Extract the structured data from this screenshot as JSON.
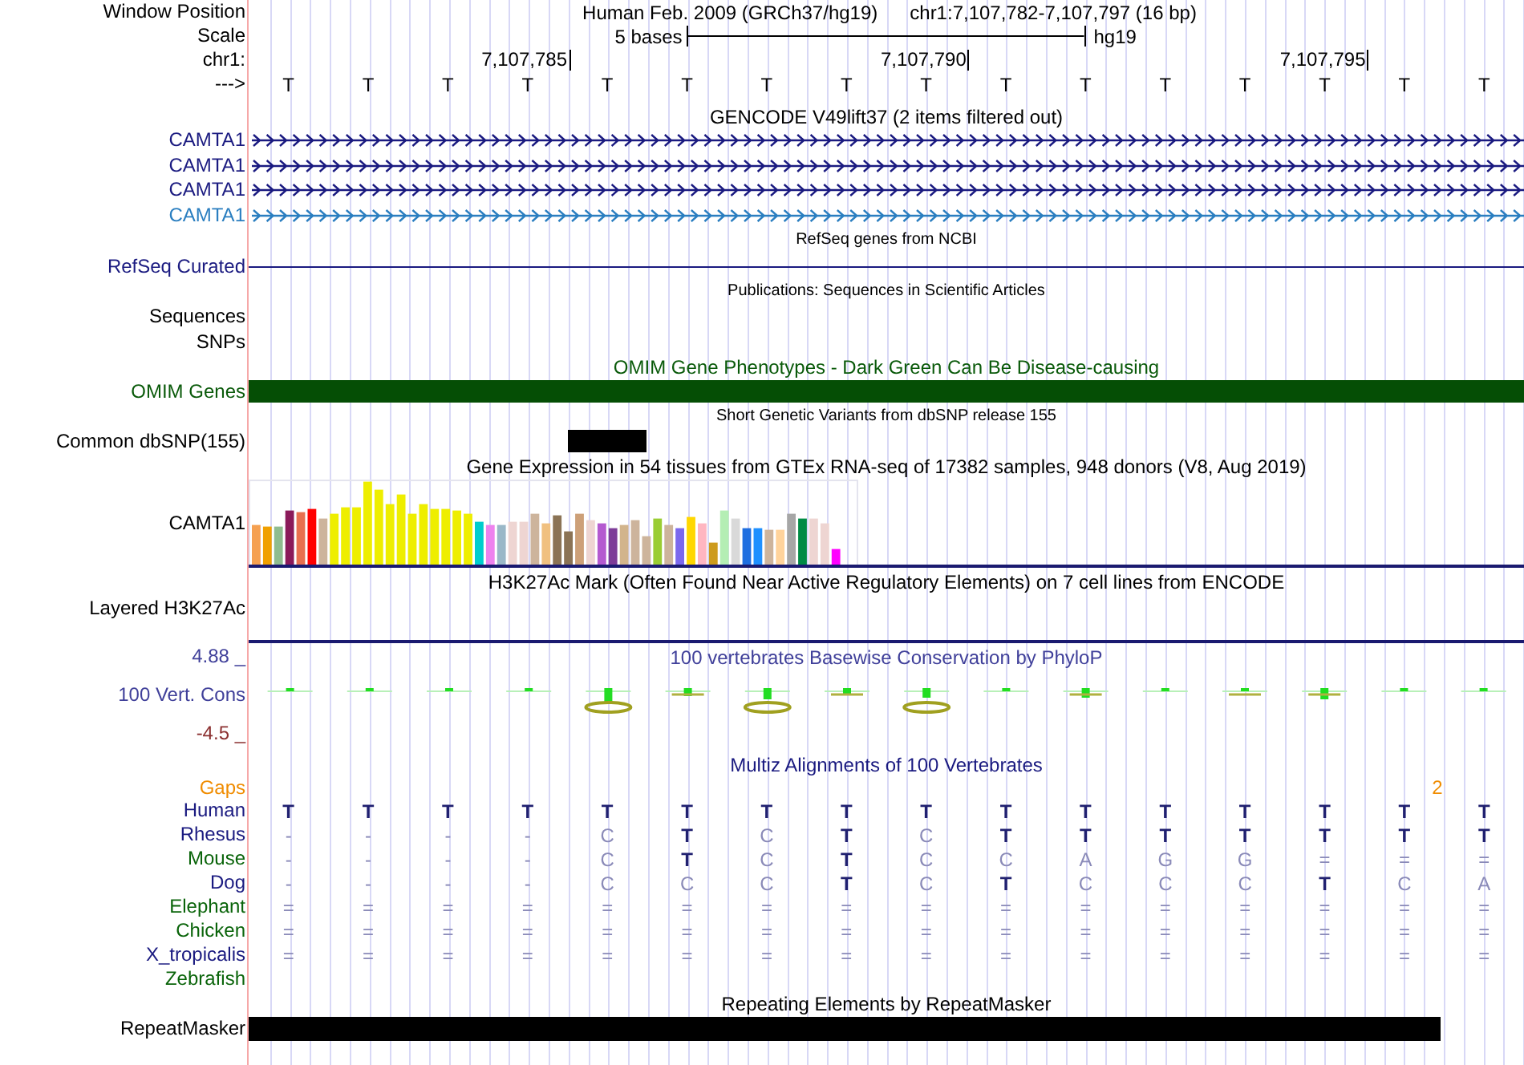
{
  "header": {
    "window_position_label": "Window Position",
    "assembly": "Human Feb. 2009 (GRCh37/hg19)",
    "position": "chr1:7,107,782-7,107,797 (16 bp)",
    "scale_label": "Scale",
    "scale_text": "5 bases",
    "scale_db": "hg19",
    "chrom_label": "chr1:",
    "ticks": [
      "7,107,785",
      "7,107,790",
      "7,107,795"
    ],
    "strand_label": "--->",
    "bases": [
      "T",
      "T",
      "T",
      "T",
      "T",
      "T",
      "T",
      "T",
      "T",
      "T",
      "T",
      "T",
      "T",
      "T",
      "T",
      "T"
    ]
  },
  "tracks": [
    {
      "kind": "gencode",
      "title": "GENCODE V49lift37 (2 items filtered out)",
      "genes": [
        {
          "label": "CAMTA1",
          "color": "#1a1a80"
        },
        {
          "label": "CAMTA1",
          "color": "#1a1a80"
        },
        {
          "label": "CAMTA1",
          "color": "#1a1a80"
        },
        {
          "label": "CAMTA1",
          "color": "#2a7ec0"
        }
      ]
    },
    {
      "kind": "refseq",
      "title": "RefSeq genes from NCBI",
      "label": "RefSeq Curated"
    },
    {
      "kind": "publications",
      "title": "Publications: Sequences in Scientific Articles",
      "labels": [
        "Sequences",
        "SNPs"
      ]
    },
    {
      "kind": "omim",
      "title": "OMIM Gene Phenotypes - Dark Green Can Be Disease-causing",
      "label": "OMIM Genes"
    },
    {
      "kind": "dbsnp",
      "title": "Short Genetic Variants from dbSNP release 155",
      "label": "Common dbSNP(155)"
    },
    {
      "kind": "gtex",
      "title": "Gene Expression in 54 tissues from GTEx RNA-seq of 17382 samples, 948 donors (V8, Aug 2019)",
      "label": "CAMTA1"
    },
    {
      "kind": "h3k27ac",
      "title": "H3K27Ac Mark (Often Found Near Active Regulatory Elements) on 7 cell lines from ENCODE",
      "label": "Layered H3K27Ac"
    },
    {
      "kind": "conservation",
      "title": "100 vertebrates Basewise Conservation by PhyloP",
      "max_label": "4.88 _",
      "label": "100 Vert. Cons",
      "min_label": "-4.5 _"
    },
    {
      "kind": "multiz",
      "title": "Multiz Alignments of 100 Vertebrates",
      "gaps_label": "Gaps",
      "gap_count": "2",
      "species": [
        {
          "name": "Human",
          "color": "#1a1a80",
          "cells": [
            {
              "base": "T",
              "match": true
            },
            {
              "base": "T",
              "match": true
            },
            {
              "base": "T",
              "match": true
            },
            {
              "base": "T",
              "match": true
            },
            {
              "base": "T",
              "match": true
            },
            {
              "base": "T",
              "match": true
            },
            {
              "base": "T",
              "match": true
            },
            {
              "base": "T",
              "match": true
            },
            {
              "base": "T",
              "match": true
            },
            {
              "base": "T",
              "match": true
            },
            {
              "base": "T",
              "match": true
            },
            {
              "base": "T",
              "match": true
            },
            {
              "base": "T",
              "match": true
            },
            {
              "base": "T",
              "match": true
            },
            {
              "base": "T",
              "match": true
            },
            {
              "base": "T",
              "match": true
            }
          ]
        },
        {
          "name": "Rhesus",
          "color": "#1a1a80",
          "cells": [
            {
              "base": "-",
              "match": false
            },
            {
              "base": "-",
              "match": false
            },
            {
              "base": "-",
              "match": false
            },
            {
              "base": "-",
              "match": false
            },
            {
              "base": "C",
              "match": false
            },
            {
              "base": "T",
              "match": true
            },
            {
              "base": "C",
              "match": false
            },
            {
              "base": "T",
              "match": true
            },
            {
              "base": "C",
              "match": false
            },
            {
              "base": "T",
              "match": true
            },
            {
              "base": "T",
              "match": true
            },
            {
              "base": "T",
              "match": true
            },
            {
              "base": "T",
              "match": true
            },
            {
              "base": "T",
              "match": true
            },
            {
              "base": "T",
              "match": true
            },
            {
              "base": "T",
              "match": true
            }
          ]
        },
        {
          "name": "Mouse",
          "color": "#0a640a",
          "cells": [
            {
              "base": "-",
              "match": false
            },
            {
              "base": "-",
              "match": false
            },
            {
              "base": "-",
              "match": false
            },
            {
              "base": "-",
              "match": false
            },
            {
              "base": "C",
              "match": false
            },
            {
              "base": "T",
              "match": true
            },
            {
              "base": "C",
              "match": false
            },
            {
              "base": "T",
              "match": true
            },
            {
              "base": "C",
              "match": false
            },
            {
              "base": "C",
              "match": false
            },
            {
              "base": "A",
              "match": false
            },
            {
              "base": "G",
              "match": false
            },
            {
              "base": "G",
              "match": false
            },
            {
              "base": "=",
              "match": false
            },
            {
              "base": "=",
              "match": false
            },
            {
              "base": "=",
              "match": false
            }
          ]
        },
        {
          "name": "Dog",
          "color": "#1a1a80",
          "cells": [
            {
              "base": "-",
              "match": false
            },
            {
              "base": "-",
              "match": false
            },
            {
              "base": "-",
              "match": false
            },
            {
              "base": "-",
              "match": false
            },
            {
              "base": "C",
              "match": false
            },
            {
              "base": "C",
              "match": false
            },
            {
              "base": "C",
              "match": false
            },
            {
              "base": "T",
              "match": true
            },
            {
              "base": "C",
              "match": false
            },
            {
              "base": "T",
              "match": true
            },
            {
              "base": "C",
              "match": false
            },
            {
              "base": "C",
              "match": false
            },
            {
              "base": "C",
              "match": false
            },
            {
              "base": "T",
              "match": true
            },
            {
              "base": "C",
              "match": false
            },
            {
              "base": "A",
              "match": false
            }
          ]
        },
        {
          "name": "Elephant",
          "color": "#0a640a",
          "cells": [
            {
              "base": "=",
              "match": false
            },
            {
              "base": "=",
              "match": false
            },
            {
              "base": "=",
              "match": false
            },
            {
              "base": "=",
              "match": false
            },
            {
              "base": "=",
              "match": false
            },
            {
              "base": "=",
              "match": false
            },
            {
              "base": "=",
              "match": false
            },
            {
              "base": "=",
              "match": false
            },
            {
              "base": "=",
              "match": false
            },
            {
              "base": "=",
              "match": false
            },
            {
              "base": "=",
              "match": false
            },
            {
              "base": "=",
              "match": false
            },
            {
              "base": "=",
              "match": false
            },
            {
              "base": "=",
              "match": false
            },
            {
              "base": "=",
              "match": false
            },
            {
              "base": "=",
              "match": false
            }
          ]
        },
        {
          "name": "Chicken",
          "color": "#0a640a",
          "cells": [
            {
              "base": "=",
              "match": false
            },
            {
              "base": "=",
              "match": false
            },
            {
              "base": "=",
              "match": false
            },
            {
              "base": "=",
              "match": false
            },
            {
              "base": "=",
              "match": false
            },
            {
              "base": "=",
              "match": false
            },
            {
              "base": "=",
              "match": false
            },
            {
              "base": "=",
              "match": false
            },
            {
              "base": "=",
              "match": false
            },
            {
              "base": "=",
              "match": false
            },
            {
              "base": "=",
              "match": false
            },
            {
              "base": "=",
              "match": false
            },
            {
              "base": "=",
              "match": false
            },
            {
              "base": "=",
              "match": false
            },
            {
              "base": "=",
              "match": false
            },
            {
              "base": "=",
              "match": false
            }
          ]
        },
        {
          "name": "X_tropicalis",
          "color": "#1a1a80",
          "cells": [
            {
              "base": "=",
              "match": false
            },
            {
              "base": "=",
              "match": false
            },
            {
              "base": "=",
              "match": false
            },
            {
              "base": "=",
              "match": false
            },
            {
              "base": "=",
              "match": false
            },
            {
              "base": "=",
              "match": false
            },
            {
              "base": "=",
              "match": false
            },
            {
              "base": "=",
              "match": false
            },
            {
              "base": "=",
              "match": false
            },
            {
              "base": "=",
              "match": false
            },
            {
              "base": "=",
              "match": false
            },
            {
              "base": "=",
              "match": false
            },
            {
              "base": "=",
              "match": false
            },
            {
              "base": "=",
              "match": false
            },
            {
              "base": "=",
              "match": false
            },
            {
              "base": "=",
              "match": false
            }
          ]
        },
        {
          "name": "Zebrafish",
          "color": "#0a640a"
        }
      ]
    },
    {
      "kind": "repeatmasker",
      "title": "Repeating Elements by RepeatMasker",
      "label": "RepeatMasker"
    }
  ]
}
